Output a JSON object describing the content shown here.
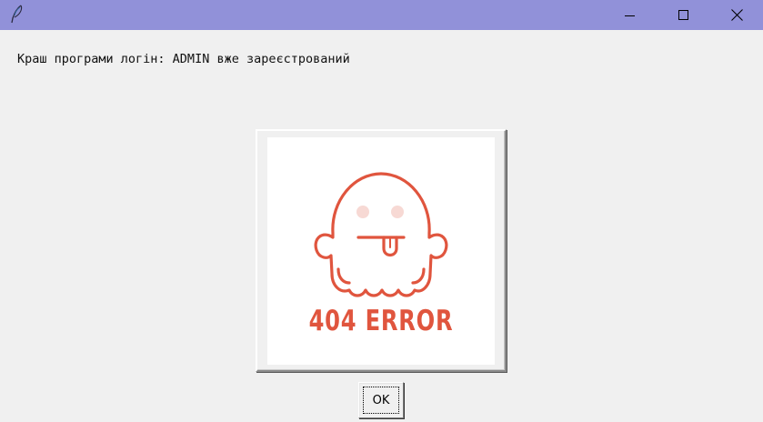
{
  "window": {
    "titlebar_color": "#9191d9",
    "app_icon": "feather-icon",
    "controls": {
      "minimize_icon": "minimize-icon",
      "maximize_icon": "maximize-icon",
      "close_icon": "close-icon"
    }
  },
  "dialog": {
    "message": "Краш програми логін: ADMIN вже зареєстрований",
    "image": {
      "icon": "ghost-icon",
      "caption": "404 ERROR",
      "accent_color": "#e0553e"
    },
    "ok_label": "OK"
  }
}
